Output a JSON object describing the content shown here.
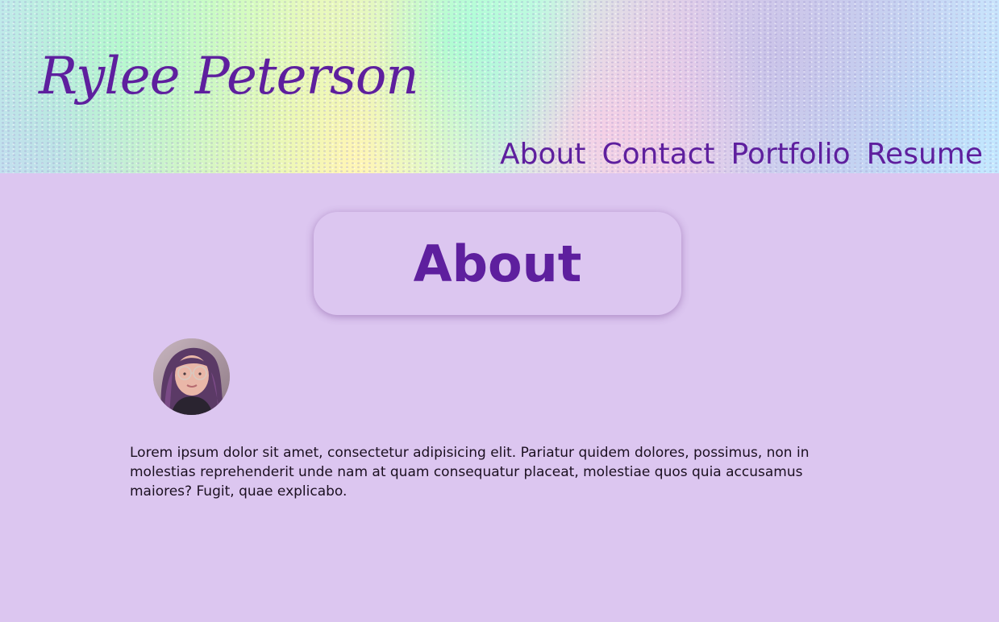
{
  "header": {
    "site_title": "Rylee Peterson",
    "nav": [
      {
        "label": "About"
      },
      {
        "label": "Contact"
      },
      {
        "label": "Portfolio"
      },
      {
        "label": "Resume"
      }
    ]
  },
  "main": {
    "heading": "About",
    "avatar_icon": "profile-photo",
    "bio": "Lorem ipsum dolor sit amet, consectetur adipisicing elit. Pariatur quidem dolores, possimus, non in molestias reprehenderit unde nam at quam consequatur placeat, molestiae quos quia accusamus maiores? Fugit, quae explicabo."
  },
  "colors": {
    "accent": "#5e1f9e",
    "page_background": "#dcc6f0",
    "body_text": "#1b1020"
  }
}
